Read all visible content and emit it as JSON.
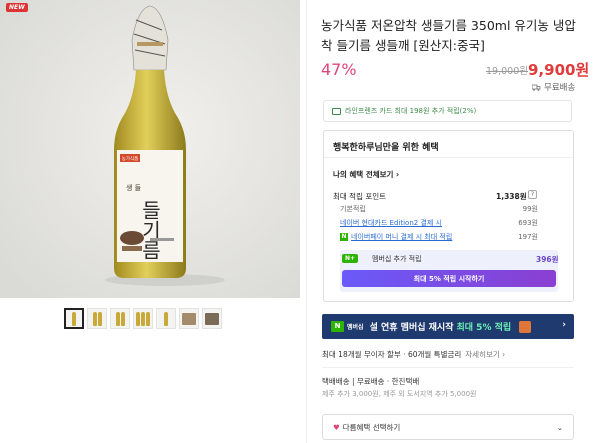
{
  "badge": "NEW",
  "product": {
    "title": "농가식품 저온압착 생들기름 350ml 유기농 냉압착 들기름 생들깨 [원산지:중국]",
    "discount": "47%",
    "original_price": "19,000원",
    "sale_price": "9,900원",
    "shipping": "무료배송"
  },
  "bottle_label": {
    "brand": "농가식품",
    "small_text": "생 들",
    "main_text": "들기름"
  },
  "thumbnails_count": 7,
  "card_banner": "라인프렌즈 카드 최대 198원 추가 적립(2%)",
  "benefits": {
    "title": "행복한하루님만을 위한 혜택",
    "my_benefits_link": "나의 혜택 전체보기",
    "max_points_label": "최대 적립 포인트",
    "max_points_value": "1,338원",
    "rows": [
      {
        "label": "기본적립",
        "value": "99원"
      },
      {
        "label": "네이버 현대카드 Edition2 결제 시",
        "value": "693원"
      },
      {
        "label": "네이버페이 머니 결제 시 최대 적립",
        "value": "197원"
      }
    ],
    "membership_label": "멤버십 추가 적립",
    "membership_value": "396원",
    "membership_button": "최대 5% 적립 시작하기"
  },
  "promo": {
    "n_mark": "N",
    "member_text": "멤버십",
    "main": "설 연휴 멤버십 재시작",
    "highlight": "최대 5% 적립"
  },
  "installment": {
    "text": "최대 18개월 무이자 할부 · 60개월 특별금리",
    "link": "자세히보기"
  },
  "delivery": {
    "text": "택배배송 | 무료배송 · 한진택배",
    "extra": "제주 추가 3,000원, 제주 외 도서지역 추가 5,000원"
  },
  "option_select": "다름혜택 선택하기"
}
